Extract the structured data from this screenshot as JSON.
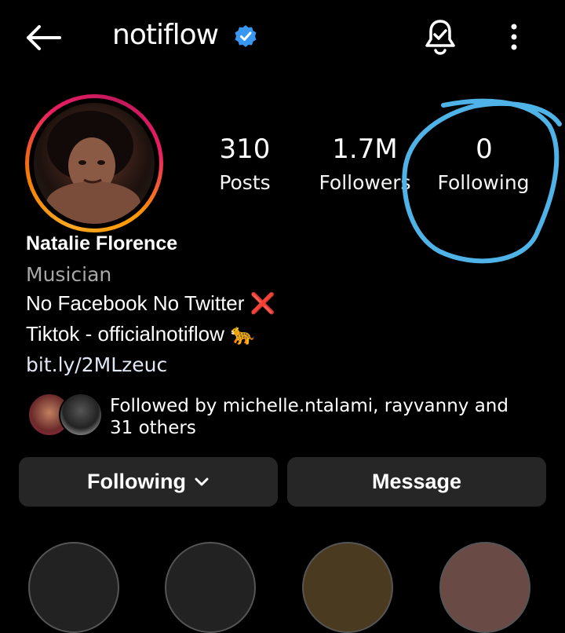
{
  "header": {
    "username": "notiflow",
    "verified": true,
    "back_icon": "back-arrow-icon",
    "bell_icon": "bell-check-icon",
    "menu_icon": "more-vertical-icon"
  },
  "stats": {
    "posts_count": "310",
    "posts_label": "Posts",
    "followers_count": "1.7M",
    "followers_label": "Followers",
    "following_count": "0",
    "following_label": "Following"
  },
  "profile": {
    "name": "Natalie Florence",
    "category": "Musician",
    "bio_line1": "No Facebook No Twitter",
    "bio_line1_emoji": "❌",
    "bio_line2": "Tiktok - officialnotiflow",
    "bio_line2_emoji": "🐆",
    "link": "bit.ly/2MLzeuc"
  },
  "followed_by": {
    "prefix": "Followed by",
    "user1": "michelle.ntalami",
    "separator": ",",
    "user2": "rayvanny",
    "and": "and",
    "count": "31",
    "suffix": "others"
  },
  "actions": {
    "following_label": "Following",
    "message_label": "Message"
  },
  "annotation_color": "#4fb3e8"
}
